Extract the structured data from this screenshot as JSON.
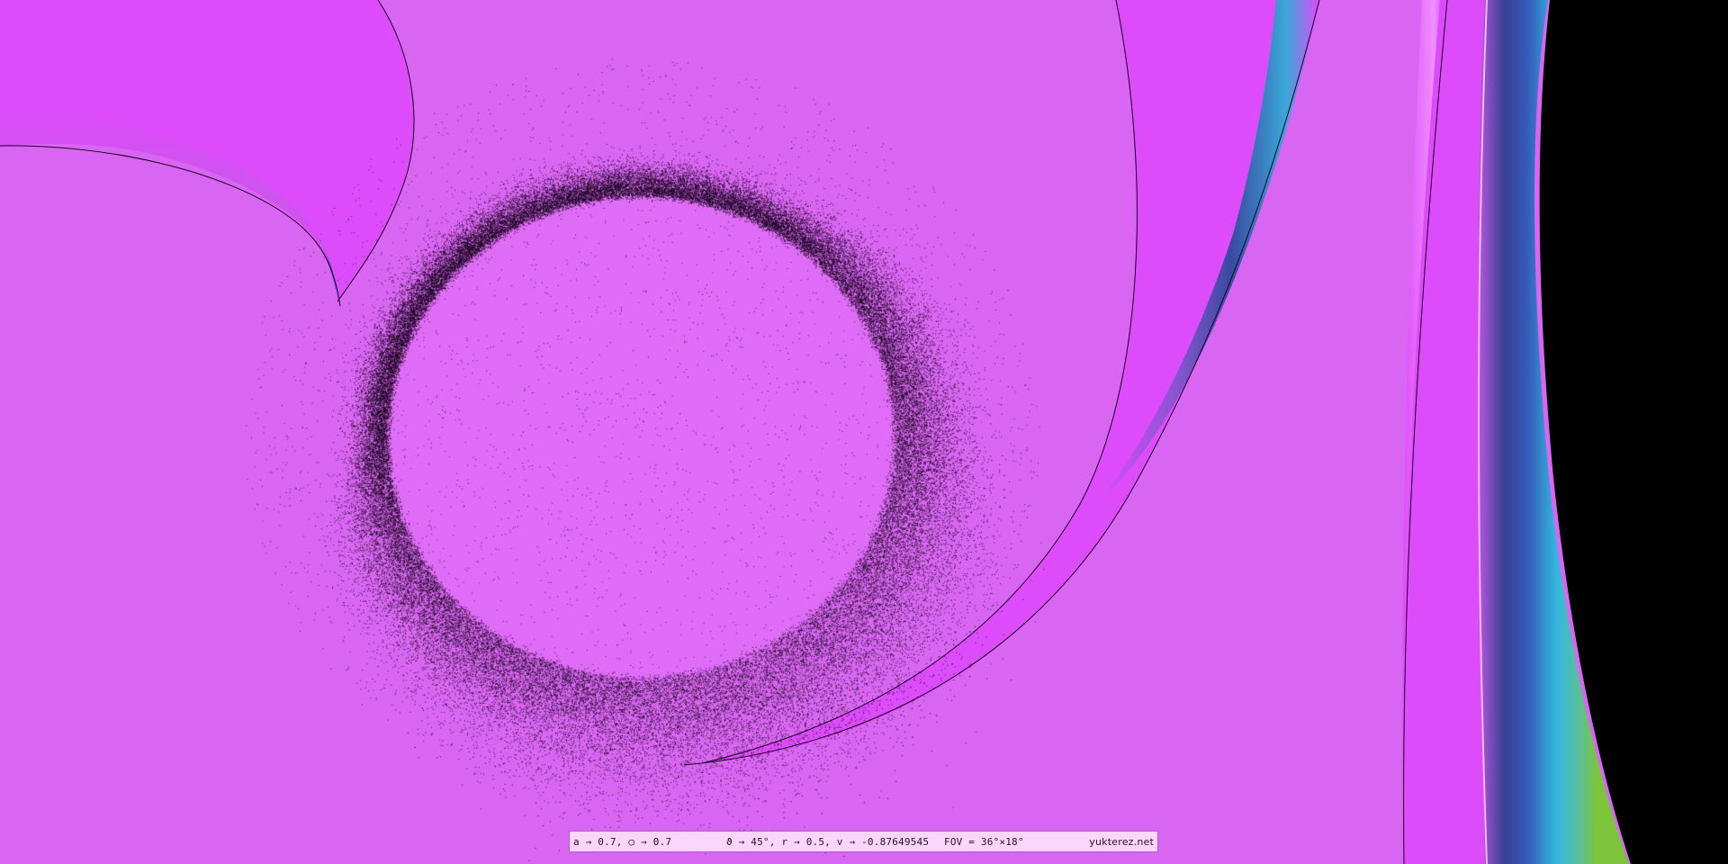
{
  "status_bar": {
    "spin_params": "a → 0.7, ○ → 0.7",
    "camera_params": "ϑ → 45°, r → 0.5, v → -0.87649545",
    "fov": "FOV = 36°×18°",
    "site": "yukterez.net"
  },
  "colors": {
    "background": "#d966f2",
    "sky_light": "#de6af5",
    "sky_dark": "#dd4cfb",
    "blue_band": "#3a4aa0",
    "cyan_band": "#33b3dc",
    "green_band": "#7cc43a",
    "void": "#000000"
  }
}
